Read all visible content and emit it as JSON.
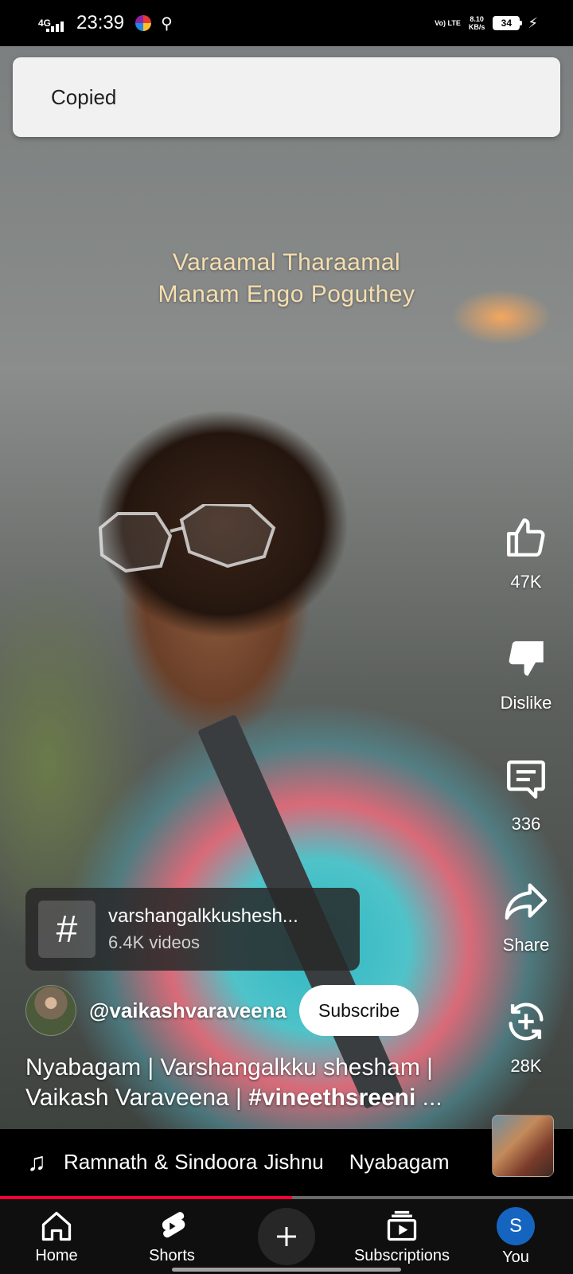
{
  "status_bar": {
    "network": "4G",
    "time": "23:39",
    "volte": "Vo) LTE",
    "speed_value": "8.10",
    "speed_unit": "KB/s",
    "battery": "34"
  },
  "toast": {
    "text": "Copied"
  },
  "video": {
    "lyrics_line1": "Varaamal Tharaamal",
    "lyrics_line2": "Manam Engo Poguthey"
  },
  "actions": {
    "like_count": "47K",
    "dislike_label": "Dislike",
    "comment_count": "336",
    "share_label": "Share",
    "remix_count": "28K"
  },
  "hashtag": {
    "title": "varshangalkkushesh...",
    "subtitle": "6.4K videos"
  },
  "channel": {
    "handle": "@vaikashvaraveena",
    "subscribe_label": "Subscribe"
  },
  "title": {
    "text_line1": "Nyabagam | Varshangalkku shesham |",
    "text_line2_prefix": "Vaikash Varaveena | ",
    "text_line2_tag": "#vineethsreeni",
    "text_line2_suffix": " ..."
  },
  "music": {
    "artist": "Ramnath & Sindoora Jishnu",
    "song": "Nyabagam"
  },
  "progress": {
    "fraction": 0.51
  },
  "nav": {
    "home": "Home",
    "shorts": "Shorts",
    "subscriptions": "Subscriptions",
    "you": "You",
    "you_initial": "S"
  },
  "colors": {
    "accent_red": "#ff0033",
    "lyrics": "#f6deb0",
    "avatar_blue": "#1565c0"
  }
}
